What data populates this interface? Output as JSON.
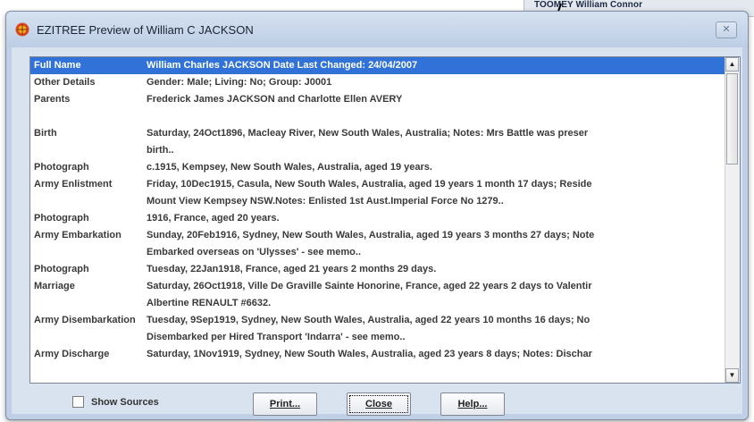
{
  "background": {
    "fragment_text": "TOOMEY William Connor"
  },
  "window": {
    "title": "EZITREE Preview of William C JACKSON",
    "close_symbol": "✕"
  },
  "details": {
    "rows": [
      {
        "label": "Full Name",
        "value": "William Charles JACKSON     Date Last Changed: 24/04/2007",
        "selected": true
      },
      {
        "label": "Other Details",
        "value": "Gender: Male; Living: No; Group: J0001"
      },
      {
        "label": "Parents",
        "value": "Frederick James JACKSON and Charlotte Ellen AVERY"
      },
      {
        "label": "",
        "value": ""
      },
      {
        "label": "Birth",
        "value": "Saturday, 24Oct1896, Macleay River, New South Wales, Australia; Notes: Mrs Battle was preser"
      },
      {
        "label": "",
        "value": "birth..",
        "cont": true
      },
      {
        "label": "Photograph",
        "value": "c.1915, Kempsey, New South Wales, Australia, aged 19 years."
      },
      {
        "label": "Army Enlistment",
        "value": "Friday, 10Dec1915, Casula, New South Wales, Australia, aged 19 years 1 month 17 days; Reside"
      },
      {
        "label": "",
        "value": "Mount View Kempsey NSW.Notes: Enlisted 1st Aust.Imperial Force No 1279..",
        "cont": true
      },
      {
        "label": "Photograph",
        "value": "1916, France, aged 20 years."
      },
      {
        "label": "Army Embarkation",
        "value": "Sunday, 20Feb1916, Sydney, New South Wales, Australia, aged 19 years 3 months 27 days; Note"
      },
      {
        "label": "",
        "value": "Embarked overseas on 'Ulysses' - see memo..",
        "cont": true
      },
      {
        "label": "Photograph",
        "value": "Tuesday, 22Jan1918, France, aged 21 years 2 months 29 days."
      },
      {
        "label": "Marriage",
        "value": "Saturday, 26Oct1918, Ville De Graville Sainte Honorine, France, aged 22 years 2 days to Valentir"
      },
      {
        "label": "",
        "value": "Albertine RENAULT #6632.",
        "cont": true
      },
      {
        "label": "Army Disembarkation",
        "value": "Tuesday, 9Sep1919, Sydney, New South Wales, Australia, aged 22 years 10 months 16 days; No"
      },
      {
        "label": "",
        "value": "Disembarked per Hired Transport 'Indarra' - see memo..",
        "cont": true
      },
      {
        "label": "Army Discharge",
        "value": "Saturday, 1Nov1919, Sydney, New South Wales, Australia, aged 23 years 8 days; Notes: Dischar"
      }
    ]
  },
  "scrollbar": {
    "up_symbol": "▲",
    "down_symbol": "▼"
  },
  "footer": {
    "show_sources_label": "Show Sources",
    "show_sources_checked": false,
    "print_label": "Print...",
    "close_label": "Close",
    "help_label": "Help..."
  },
  "colors": {
    "selection": "#3072d8",
    "window_frame": "#bfd0e6"
  }
}
